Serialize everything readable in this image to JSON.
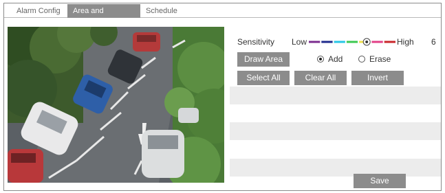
{
  "tabs": [
    {
      "label": "Alarm Config",
      "active": false
    },
    {
      "label": "Area and Sensitivity",
      "active": true
    },
    {
      "label": "Schedule",
      "active": false
    }
  ],
  "sensitivity": {
    "label": "Sensitivity",
    "low_label": "Low",
    "high_label": "High",
    "value": "6",
    "level_fraction": 0.6,
    "segment_colors": [
      "#7b2c8f",
      "#1f2a8c",
      "#27c6e6",
      "#3cc850",
      "#f0e24a",
      "#e23f86",
      "#c9262a"
    ]
  },
  "buttons": {
    "draw_area": "Draw Area",
    "select_all": "Select All",
    "clear_all": "Clear All",
    "invert": "Invert",
    "save": "Save"
  },
  "mode": {
    "add_label": "Add",
    "erase_label": "Erase",
    "selected": "Add"
  },
  "colors": {
    "active_tab": "#8c8c8c",
    "button": "#8c8c8c",
    "stripe": "#ececec"
  }
}
